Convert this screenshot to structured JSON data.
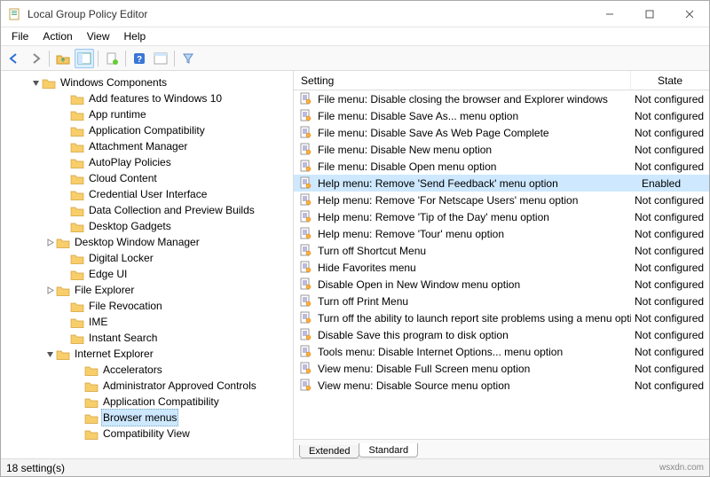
{
  "window": {
    "title": "Local Group Policy Editor",
    "btn_min": "–",
    "btn_max": "☐",
    "btn_close": "✕"
  },
  "menubar": [
    "File",
    "Action",
    "View",
    "Help"
  ],
  "toolbar_icons": [
    "back",
    "forward",
    "up",
    "toggle-tree",
    "properties",
    "refresh",
    "export",
    "help",
    "show-hide",
    "filter"
  ],
  "tree": [
    {
      "indent": 1,
      "exp": "open",
      "label": "Windows Components"
    },
    {
      "indent": 3,
      "label": "Add features to Windows 10"
    },
    {
      "indent": 3,
      "label": "App runtime"
    },
    {
      "indent": 3,
      "label": "Application Compatibility"
    },
    {
      "indent": 3,
      "label": "Attachment Manager"
    },
    {
      "indent": 3,
      "label": "AutoPlay Policies"
    },
    {
      "indent": 3,
      "label": "Cloud Content"
    },
    {
      "indent": 3,
      "label": "Credential User Interface"
    },
    {
      "indent": 3,
      "label": "Data Collection and Preview Builds"
    },
    {
      "indent": 3,
      "label": "Desktop Gadgets"
    },
    {
      "indent": 2,
      "exp": "closed",
      "label": "Desktop Window Manager"
    },
    {
      "indent": 3,
      "label": "Digital Locker"
    },
    {
      "indent": 3,
      "label": "Edge UI"
    },
    {
      "indent": 2,
      "exp": "closed",
      "label": "File Explorer"
    },
    {
      "indent": 3,
      "label": "File Revocation"
    },
    {
      "indent": 3,
      "label": "IME"
    },
    {
      "indent": 3,
      "label": "Instant Search"
    },
    {
      "indent": 2,
      "exp": "open",
      "label": "Internet Explorer"
    },
    {
      "indent": 4,
      "label": "Accelerators"
    },
    {
      "indent": 4,
      "label": "Administrator Approved Controls"
    },
    {
      "indent": 4,
      "label": "Application Compatibility"
    },
    {
      "indent": 4,
      "label": "Browser menus",
      "selected": true
    },
    {
      "indent": 4,
      "label": "Compatibility View"
    }
  ],
  "columns": {
    "setting": "Setting",
    "state": "State"
  },
  "settings": [
    {
      "name": "File menu: Disable closing the browser and Explorer windows",
      "state": "Not configured"
    },
    {
      "name": "File menu: Disable Save As... menu option",
      "state": "Not configured"
    },
    {
      "name": "File menu: Disable Save As Web Page Complete",
      "state": "Not configured"
    },
    {
      "name": "File menu: Disable New menu option",
      "state": "Not configured"
    },
    {
      "name": "File menu: Disable Open menu option",
      "state": "Not configured"
    },
    {
      "name": "Help menu: Remove 'Send Feedback' menu option",
      "state": "Enabled",
      "selected": true
    },
    {
      "name": "Help menu: Remove 'For Netscape Users' menu option",
      "state": "Not configured"
    },
    {
      "name": "Help menu: Remove 'Tip of the Day' menu option",
      "state": "Not configured"
    },
    {
      "name": "Help menu: Remove 'Tour' menu option",
      "state": "Not configured"
    },
    {
      "name": "Turn off Shortcut Menu",
      "state": "Not configured"
    },
    {
      "name": "Hide Favorites menu",
      "state": "Not configured"
    },
    {
      "name": "Disable Open in New Window menu option",
      "state": "Not configured"
    },
    {
      "name": "Turn off Print Menu",
      "state": "Not configured"
    },
    {
      "name": "Turn off the ability to launch report site problems using a menu option",
      "state": "Not configured"
    },
    {
      "name": "Disable Save this program to disk option",
      "state": "Not configured"
    },
    {
      "name": "Tools menu: Disable Internet Options... menu option",
      "state": "Not configured"
    },
    {
      "name": "View menu: Disable Full Screen menu option",
      "state": "Not configured"
    },
    {
      "name": "View menu: Disable Source menu option",
      "state": "Not configured"
    }
  ],
  "tabs": {
    "extended": "Extended",
    "standard": "Standard"
  },
  "status": {
    "left": "18 setting(s)",
    "right": "wsxdn.com"
  }
}
